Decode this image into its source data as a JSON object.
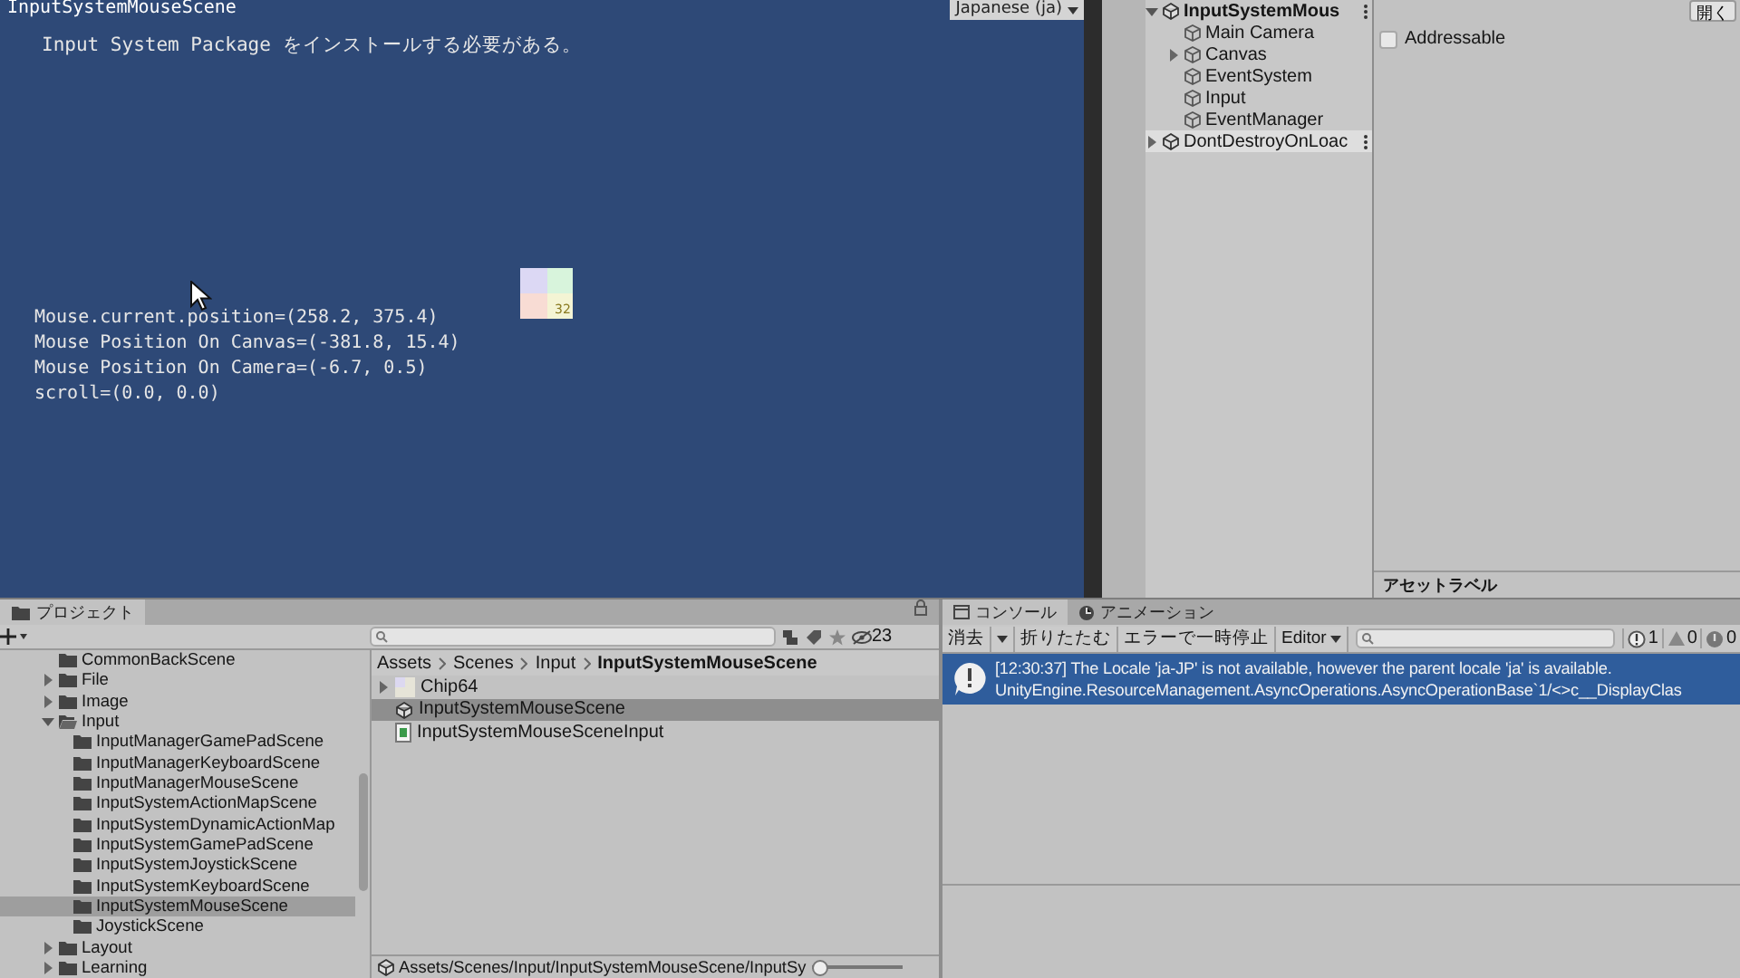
{
  "game_view": {
    "title": "InputSystemMouseScene",
    "language_dropdown": "Japanese (ja)",
    "message": "Input System Package をインストールする必要がある。",
    "readouts": [
      "Mouse.current.position=(258.2, 375.4)",
      "Mouse Position On Canvas=(-381.8, 15.4)",
      "Mouse Position On Camera=(-6.7, 0.5)",
      "scroll=(0.0, 0.0)"
    ],
    "sprite_label": "32"
  },
  "hierarchy": {
    "scenes": [
      {
        "name": "InputSystemMous",
        "expanded": true,
        "selected": false,
        "children": [
          {
            "label": "Main Camera",
            "expandable": false
          },
          {
            "label": "Canvas",
            "expandable": true
          },
          {
            "label": "EventSystem",
            "expandable": false
          },
          {
            "label": "Input",
            "expandable": false
          },
          {
            "label": "EventManager",
            "expandable": false
          }
        ]
      },
      {
        "name": "DontDestroyOnLoac",
        "expanded": false,
        "selected": true
      }
    ]
  },
  "inspector": {
    "open_button": "開く",
    "addressable": {
      "label": "Addressable",
      "checked": false
    },
    "asset_labels": "アセットラベル"
  },
  "project": {
    "tab": "プロジェクト",
    "hidden_count": "23",
    "tree": [
      {
        "label": "CommonBackScene",
        "expandable": false,
        "expanded": false,
        "selected": false
      },
      {
        "label": "File",
        "expandable": true,
        "expanded": false,
        "selected": false
      },
      {
        "label": "Image",
        "expandable": true,
        "expanded": false,
        "selected": false
      },
      {
        "label": "Input",
        "expandable": true,
        "expanded": true,
        "selected": false,
        "children": [
          {
            "label": "InputManagerGamePadScene",
            "selected": false
          },
          {
            "label": "InputManagerKeyboardScene",
            "selected": false
          },
          {
            "label": "InputManagerMouseScene",
            "selected": false
          },
          {
            "label": "InputSystemActionMapScene",
            "selected": false
          },
          {
            "label": "InputSystemDynamicActionMap",
            "selected": false
          },
          {
            "label": "InputSystemGamePadScene",
            "selected": false
          },
          {
            "label": "InputSystemJoystickScene",
            "selected": false
          },
          {
            "label": "InputSystemKeyboardScene",
            "selected": false
          },
          {
            "label": "InputSystemMouseScene",
            "selected": true
          },
          {
            "label": "JoystickScene",
            "selected": false
          }
        ]
      },
      {
        "label": "Layout",
        "expandable": true,
        "expanded": false,
        "selected": false
      },
      {
        "label": "Learning",
        "expandable": true,
        "expanded": false,
        "selected": false
      }
    ],
    "breadcrumb": [
      "Assets",
      "Scenes",
      "Input",
      "InputSystemMouseScene"
    ],
    "files": [
      {
        "label": "Chip64",
        "kind": "texture",
        "selected": false
      },
      {
        "label": "InputSystemMouseScene",
        "kind": "scene",
        "selected": true
      },
      {
        "label": "InputSystemMouseSceneInput",
        "kind": "script",
        "selected": false
      }
    ],
    "path": "Assets/Scenes/Input/InputSystemMouseScene/InputSy",
    "zoom": {
      "level": 0
    }
  },
  "console": {
    "tabs": [
      {
        "label": "コンソール",
        "kind": "console",
        "selected": true
      },
      {
        "label": "アニメーション",
        "kind": "animation",
        "selected": false
      }
    ],
    "toolbar": {
      "clear": "消去",
      "collapse": "折りたたむ",
      "error_pause": "エラーで一時停止",
      "target": "Editor"
    },
    "counts": {
      "info": "1",
      "warning": "0",
      "error": "0"
    },
    "messages": [
      {
        "kind": "info",
        "selected": true,
        "lines": [
          "[12:30:37] The Locale 'ja-JP' is not available, however the parent locale 'ja' is available.",
          "UnityEngine.ResourceManagement.AsyncOperations.AsyncOperationBase`1/<>c__DisplayClas"
        ]
      }
    ]
  }
}
